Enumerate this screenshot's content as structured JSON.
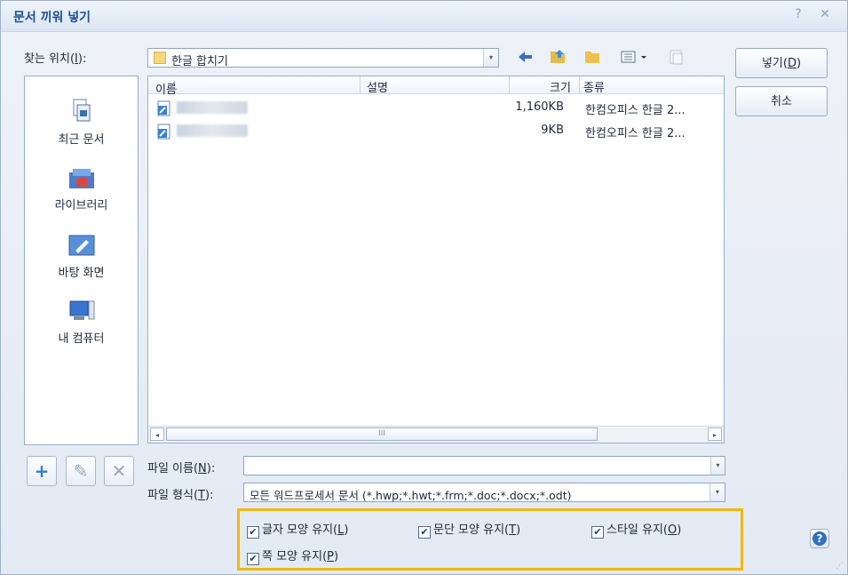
{
  "window": {
    "title": "문서 끼워 넣기",
    "help_glyph": "?",
    "close_glyph": "✕"
  },
  "location": {
    "label_pre": "찾는 위치(",
    "label_key": "I",
    "label_post": "):",
    "value": "한글 합치기"
  },
  "places": [
    {
      "label": "최근 문서",
      "icon": "recent-documents-icon"
    },
    {
      "label": "라이브러리",
      "icon": "library-icon"
    },
    {
      "label": "바탕 화면",
      "icon": "desktop-icon"
    },
    {
      "label": "내 컴퓨터",
      "icon": "my-computer-icon"
    }
  ],
  "columns": {
    "name": "이름",
    "sort_glyph": "∠",
    "description": "설명",
    "size": "크기",
    "type": "종류"
  },
  "files": [
    {
      "size": "1,160KB",
      "type": "한컴오피스 한글 2..."
    },
    {
      "size": "9KB",
      "type": "한컴오피스 한글 2..."
    }
  ],
  "scroll": {
    "left": "◂",
    "right": "▸",
    "thumb": "III"
  },
  "buttons": {
    "insert_pre": "넣기(",
    "insert_key": "D",
    "insert_post": ")",
    "cancel": "취소",
    "add": "+",
    "edit": "✎",
    "delete": "✕"
  },
  "filename": {
    "label_pre": "파일 이름(",
    "label_key": "N",
    "label_post": "):",
    "value": ""
  },
  "filetype": {
    "label_pre": "파일 형식(",
    "label_key": "T",
    "label_post": "):",
    "value": "모든 워드프로세서 문서 (*.hwp;*.hwt;*.frm;*.doc;*.docx;*.odt)"
  },
  "options": [
    {
      "pre": "글자 모양 유지(",
      "key": "L",
      "post": ")",
      "checked": true
    },
    {
      "pre": "문단 모양 유지(",
      "key": "T",
      "post": ")",
      "checked": true
    },
    {
      "pre": "스타일 유지(",
      "key": "O",
      "post": ")",
      "checked": true
    },
    {
      "pre": "쪽 모양 유지(",
      "key": "P",
      "post": ")",
      "checked": true
    }
  ],
  "check_glyph": "✔",
  "combo_arrow": "▾",
  "colors": {
    "highlight": "#f2b70f",
    "title": "#1e4f94"
  }
}
